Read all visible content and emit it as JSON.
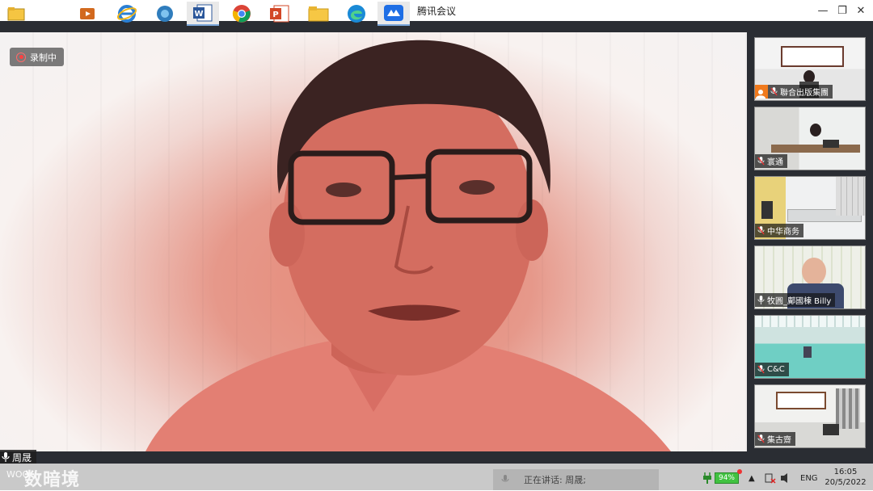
{
  "window": {
    "title": "腾讯会议",
    "controls": {
      "minimize": "—",
      "maximize": "❐",
      "close": "✕"
    }
  },
  "recording": {
    "label": "录制中"
  },
  "main_speaker": {
    "name": "周晟"
  },
  "participants": [
    {
      "name": "聯合出版集團",
      "icon": "person-avatar-icon"
    },
    {
      "name": "寰通",
      "icon": "mic-icon"
    },
    {
      "name": "中华商务",
      "icon": "mic-icon"
    },
    {
      "name": "牧圓_鄺國棟 Billy",
      "icon": "mic-icon"
    },
    {
      "name": "C&C",
      "icon": "mic-icon"
    },
    {
      "name": "集古齋",
      "icon": "mic-icon"
    }
  ],
  "taskbar": {
    "watermark": "数暗境",
    "watermark_prefix": "WOO",
    "speaking_now": "正在讲话: 周晟;",
    "battery": "94%",
    "language": "ENG",
    "time": "16:05",
    "date": "20/5/2022",
    "apps": [
      "file-explorer-icon",
      "start-icon",
      "ie-icon",
      "media-icon",
      "word-icon",
      "chrome-icon",
      "powerpoint-icon",
      "folder-icon",
      "edge-icon",
      "tencent-meeting-icon"
    ]
  },
  "colors": {
    "accent": "#f07a1d",
    "recording": "#ff4040",
    "battery": "#41c241"
  }
}
